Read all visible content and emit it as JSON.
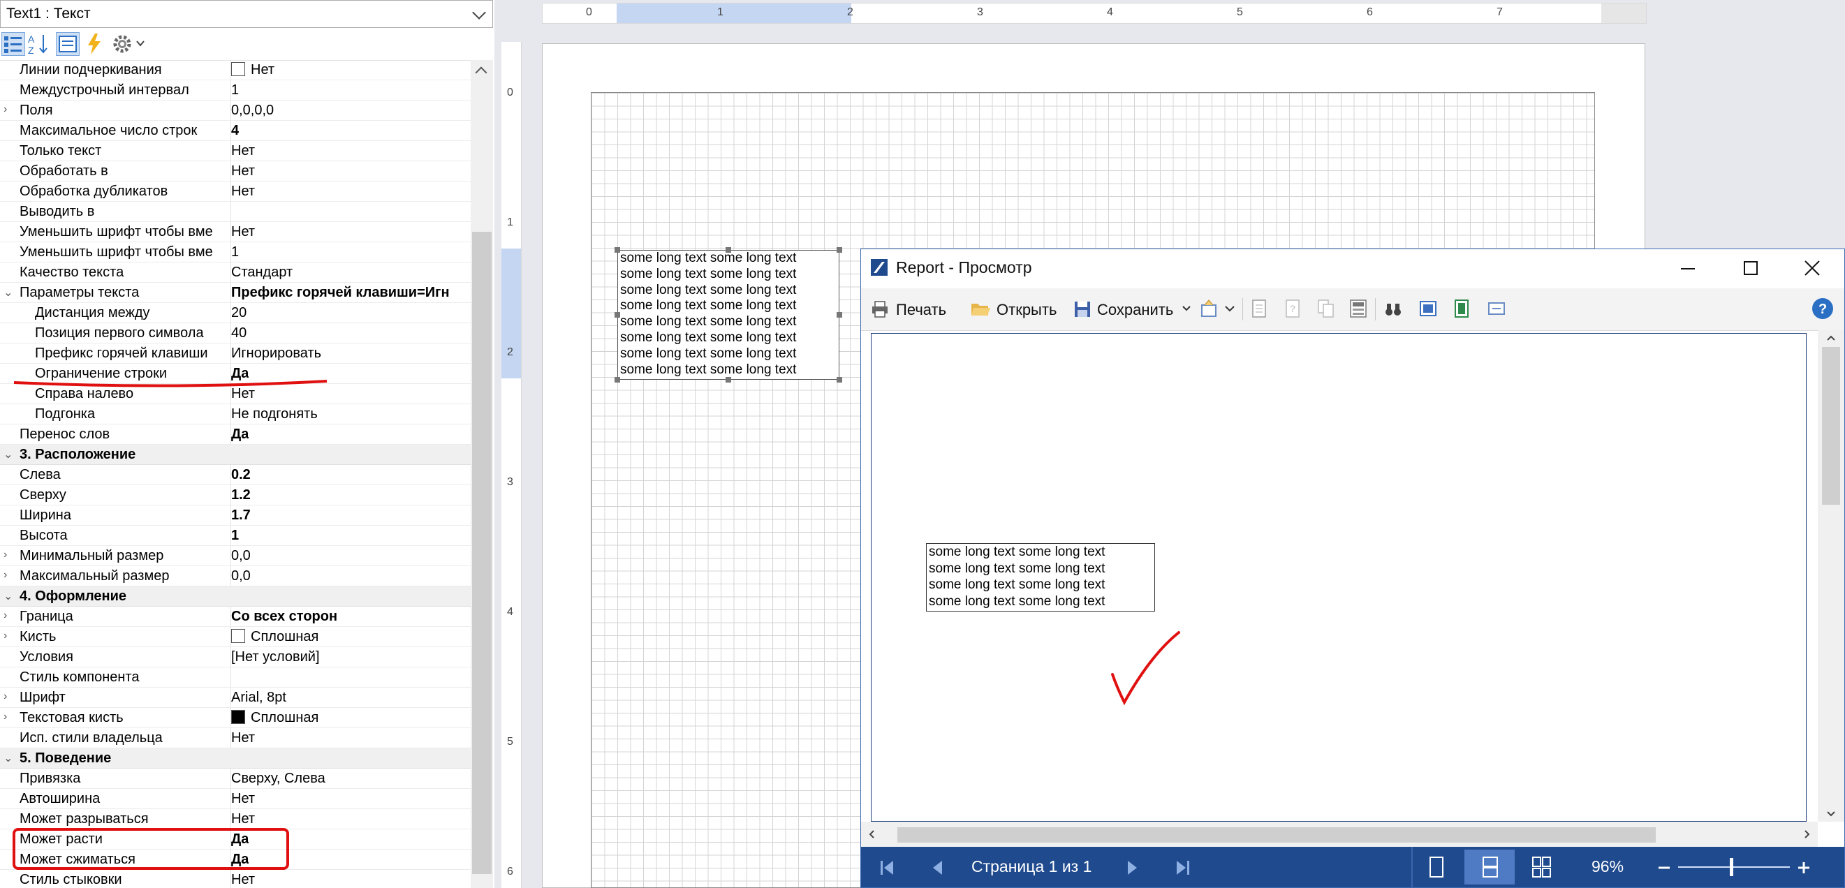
{
  "component_selector": {
    "value": "Text1 : Текст"
  },
  "properties": [
    {
      "name": "Линии подчеркивания",
      "value": "Нет",
      "indent": 0,
      "checkbox": "white"
    },
    {
      "name": "Междустрочный интервал",
      "value": "1",
      "indent": 0
    },
    {
      "name": "Поля",
      "value": "0,0,0,0",
      "indent": 0,
      "expander": "›"
    },
    {
      "name": "Максимальное число строк",
      "value": "4",
      "indent": 0,
      "bold": true
    },
    {
      "name": "Только текст",
      "value": "Нет",
      "indent": 0
    },
    {
      "name": "Обработать в",
      "value": "Нет",
      "indent": 0
    },
    {
      "name": "Обработка дубликатов",
      "value": "Нет",
      "indent": 0
    },
    {
      "name": "Выводить в",
      "value": "",
      "indent": 0
    },
    {
      "name": "Уменьшить шрифт чтобы вме",
      "value": "Нет",
      "indent": 0
    },
    {
      "name": "Уменьшить шрифт чтобы вме",
      "value": "1",
      "indent": 0
    },
    {
      "name": "Качество текста",
      "value": "Стандарт",
      "indent": 0
    },
    {
      "name": "Параметры текста",
      "value": "Префикс горячей клавиши=Игн",
      "indent": 0,
      "expander": "⌄",
      "bold": true,
      "group": true
    },
    {
      "name": "Дистанция между",
      "value": "20",
      "indent": 1
    },
    {
      "name": "Позиция первого символа",
      "value": "40",
      "indent": 1
    },
    {
      "name": "Префикс горячей клавиши",
      "value": "Игнорировать",
      "indent": 1
    },
    {
      "name": "Ограничение строки",
      "value": "Да",
      "indent": 1,
      "bold": true
    },
    {
      "name": "Справа налево",
      "value": "Нет",
      "indent": 1
    },
    {
      "name": "Подгонка",
      "value": "Не подгонять",
      "indent": 1
    },
    {
      "name": "Перенос слов",
      "value": "Да",
      "indent": 0,
      "bold": true
    },
    {
      "name": "3. Расположение",
      "value": "",
      "category": true
    },
    {
      "name": "Слева",
      "value": "0.2",
      "indent": 0,
      "bold": true
    },
    {
      "name": "Сверху",
      "value": "1.2",
      "indent": 0,
      "bold": true
    },
    {
      "name": "Ширина",
      "value": "1.7",
      "indent": 0,
      "bold": true
    },
    {
      "name": "Высота",
      "value": "1",
      "indent": 0,
      "bold": true
    },
    {
      "name": "Минимальный размер",
      "value": "0,0",
      "indent": 0,
      "expander": "›"
    },
    {
      "name": "Максимальный размер",
      "value": "0,0",
      "indent": 0,
      "expander": "›"
    },
    {
      "name": "4. Оформление",
      "value": "",
      "category": true
    },
    {
      "name": "Граница",
      "value": "Со всех сторон",
      "indent": 0,
      "expander": "›",
      "bold": true
    },
    {
      "name": "Кисть",
      "value": "Сплошная",
      "indent": 0,
      "expander": "›",
      "checkbox": "white"
    },
    {
      "name": "Условия",
      "value": "[Нет условий]",
      "indent": 0
    },
    {
      "name": "Стиль компонента",
      "value": "",
      "indent": 0
    },
    {
      "name": "Шрифт",
      "value": "Arial, 8pt",
      "indent": 0,
      "expander": "›"
    },
    {
      "name": "Текстовая кисть",
      "value": "Сплошная",
      "indent": 0,
      "expander": "›",
      "checkbox": "black"
    },
    {
      "name": "Исп. стили владельца",
      "value": "Нет",
      "indent": 0
    },
    {
      "name": "5. Поведение",
      "value": "",
      "category": true
    },
    {
      "name": "Привязка",
      "value": "Сверху, Слева",
      "indent": 0
    },
    {
      "name": "Автоширина",
      "value": "Нет",
      "indent": 0
    },
    {
      "name": "Может разрываться",
      "value": "Нет",
      "indent": 0
    },
    {
      "name": "Может расти",
      "value": "Да",
      "indent": 0,
      "bold": true
    },
    {
      "name": "Может сжиматься",
      "value": "Да",
      "indent": 0,
      "bold": true
    },
    {
      "name": "Стиль стыковки",
      "value": "Нет",
      "indent": 0
    }
  ],
  "ruler": {
    "horizontal": [
      "0",
      "1",
      "2",
      "3",
      "4",
      "5",
      "6",
      "7"
    ],
    "vertical": [
      "0",
      "1",
      "2",
      "3",
      "4",
      "5",
      "6"
    ]
  },
  "design_text_lines": [
    "some long text some long text",
    "some long text some long text",
    "some long text some long text",
    "some long text some long text",
    "some long text some long text",
    "some long text some long text",
    "some long text some long text",
    "some long text some long text"
  ],
  "preview": {
    "title": "Report - Просмотр",
    "toolbar": {
      "print": "Печать",
      "open": "Открыть",
      "save": "Сохранить"
    },
    "text_lines": [
      "some long text some long text",
      "some long text some long text",
      "some long text some long text",
      "some long text some long text"
    ],
    "status": {
      "page_text": "Страница 1 из 1",
      "zoom": "96%"
    }
  },
  "colors": {
    "annotation_red": "#e01010",
    "status_bar": "#1f4a8e",
    "window_border": "#3c6cb4"
  }
}
